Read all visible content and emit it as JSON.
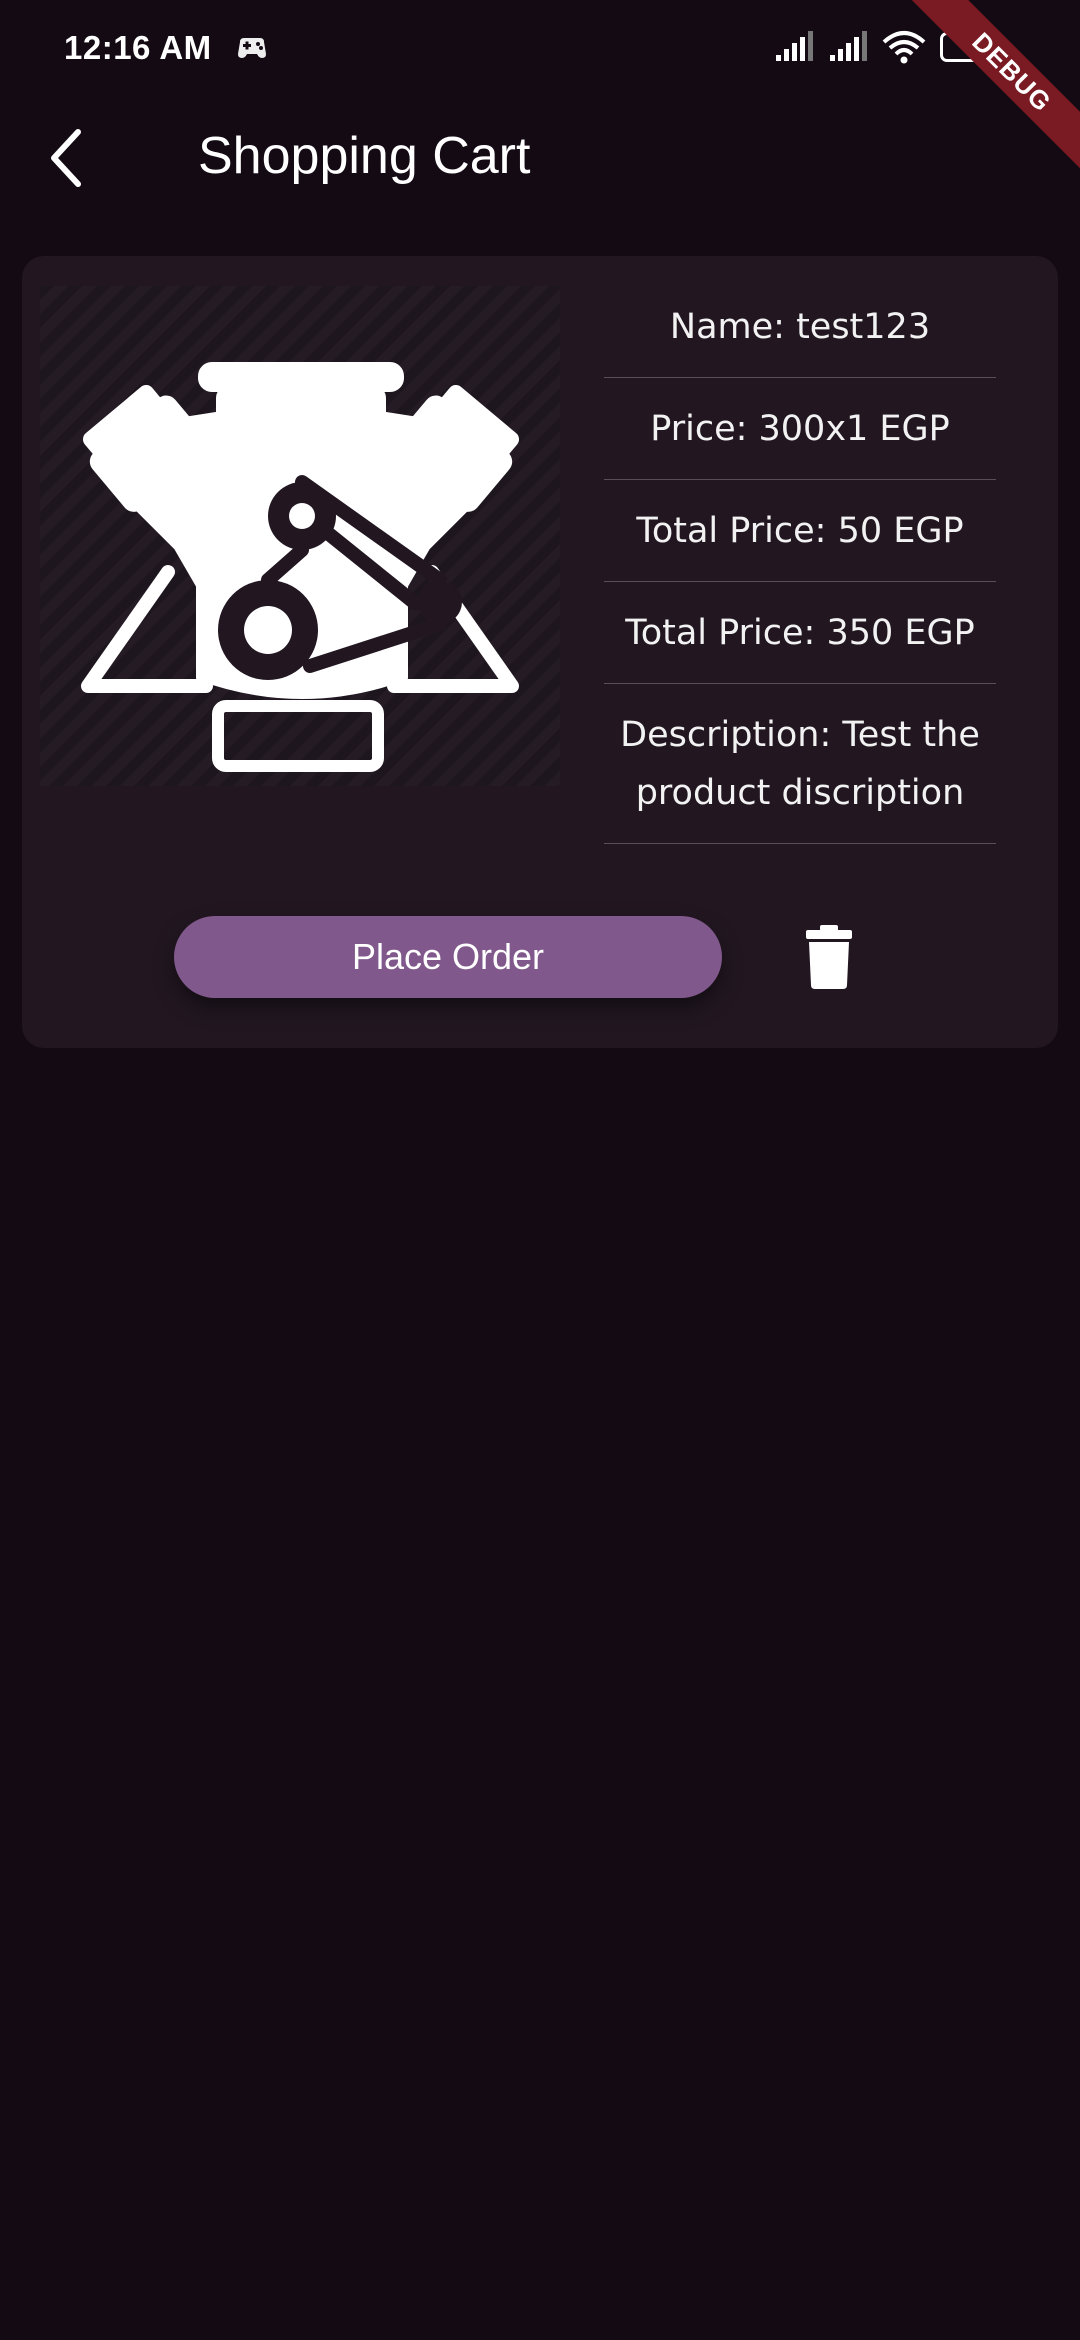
{
  "status_bar": {
    "time": "12:16 AM",
    "app_icon": "game-controller-icon",
    "battery_level": "3",
    "icons": [
      "signal-icon",
      "signal-icon",
      "wifi-icon",
      "battery-icon"
    ]
  },
  "debug_banner": "DEBUG",
  "app_bar": {
    "title": "Shopping Cart",
    "back_icon": "chevron-left-icon"
  },
  "cart_item": {
    "image_icon": "engine-icon",
    "name": "Name: test123",
    "price": "Price: 300x1 EGP",
    "total_price_a": "Total Price: 50 EGP",
    "total_price_b": "Total Price: 350 EGP",
    "description_line1": "Description: Test the",
    "description_line2": "product discription",
    "place_order_label": "Place Order",
    "delete_icon": "trash-icon"
  },
  "colors": {
    "background": "#130a13",
    "card": "#221721",
    "accent": "#81588c",
    "debug": "#7a1a22"
  }
}
